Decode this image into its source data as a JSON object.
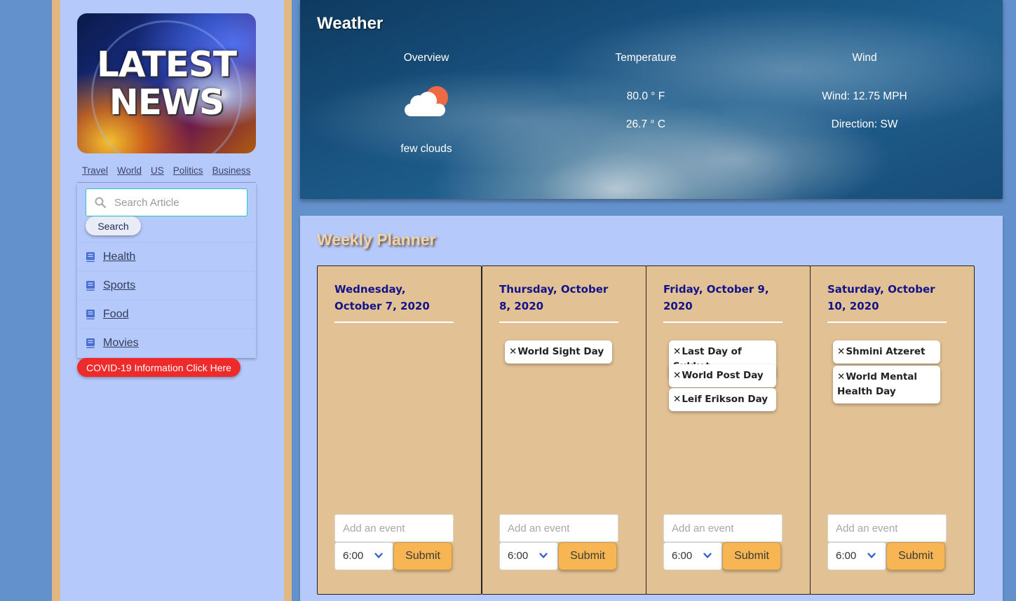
{
  "logo": {
    "line1": "LATEST",
    "line2": "NEWS"
  },
  "topnav": [
    "Travel",
    "World",
    "US",
    "Politics",
    "Business"
  ],
  "search": {
    "placeholder": "Search Article",
    "button_label": "Search"
  },
  "categories": [
    {
      "label": "Health",
      "icon": "book-icon"
    },
    {
      "label": "Sports",
      "icon": "book-icon"
    },
    {
      "label": "Food",
      "icon": "book-icon"
    },
    {
      "label": "Movies",
      "icon": "book-icon"
    }
  ],
  "covid_button": "COVID-19 Information Click Here",
  "weather": {
    "title": "Weather",
    "overview": {
      "header": "Overview",
      "condition": "few clouds",
      "icon": "partly-cloudy-icon"
    },
    "temperature": {
      "header": "Temperature",
      "fahrenheit": "80.0 ° F",
      "celsius": "26.7 ° C"
    },
    "wind": {
      "header": "Wind",
      "speed": "Wind: 12.75 MPH",
      "direction": "Direction: SW"
    }
  },
  "planner": {
    "title": "Weekly Planner",
    "add_placeholder": "Add an event",
    "time_value": "6:00",
    "submit_label": "Submit",
    "remove_glyph": "✕",
    "days": [
      {
        "date": "Wednesday, October 7, 2020",
        "events": []
      },
      {
        "date": "Thursday, October 8, 2020",
        "events": [
          "World Sight Day"
        ]
      },
      {
        "date": "Friday, October 9, 2020",
        "events": [
          "Last Day of Sukkot",
          "World Post Day",
          "Leif Erikson Day"
        ]
      },
      {
        "date": "Saturday, October 10, 2020",
        "events": [
          "Shmini Atzeret",
          "World Mental Health Day"
        ]
      }
    ]
  },
  "colors": {
    "page_bg": "#6391cc",
    "sidebar_bg": "#b6c9fb",
    "sidebar_frame": "#e2b781",
    "day_card": "#e2c195",
    "date_text": "#13138a",
    "submit_bg": "#f7b553",
    "covid_bg": "#ee2a2a"
  }
}
